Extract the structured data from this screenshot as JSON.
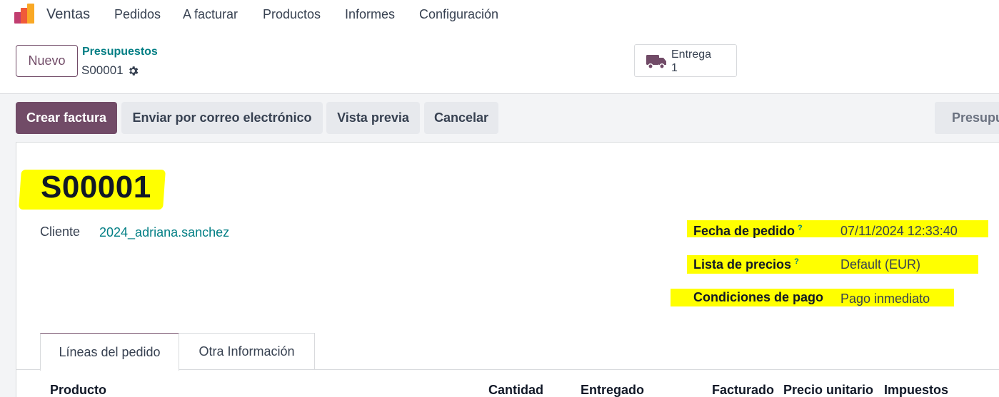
{
  "nav": {
    "app_name": "Ventas",
    "menu": [
      "Pedidos",
      "A facturar",
      "Productos",
      "Informes",
      "Configuración"
    ]
  },
  "control": {
    "new_label": "Nuevo",
    "breadcrumb": "Presupuestos",
    "record": "S00001",
    "smart_button": {
      "label": "Entrega",
      "value": "1",
      "icon": "truck-icon"
    }
  },
  "actions": {
    "create_invoice": "Crear factura",
    "send_email": "Enviar por correo electrónico",
    "preview": "Vista previa",
    "cancel": "Cancelar",
    "stage": "Presupuesto"
  },
  "form": {
    "title": "S00001",
    "customer_label": "Cliente",
    "customer_value": "2024_adriana.sanchez",
    "order_date_label": "Fecha de pedido",
    "order_date_value": "07/11/2024 12:33:40",
    "pricelist_label": "Lista de precios",
    "pricelist_value": "Default (EUR)",
    "payment_terms_label": "Condiciones de pago",
    "payment_terms_value": "Pago inmediato",
    "help_mark": "?"
  },
  "tabs": [
    "Líneas del pedido",
    "Otra Información"
  ],
  "columns": [
    "Producto",
    "Cantidad",
    "Entregado",
    "Facturado",
    "Precio unitario",
    "Impuestos"
  ],
  "colors": {
    "brand": "#714b67",
    "link": "#017e84",
    "highlight": "#ffff00"
  }
}
